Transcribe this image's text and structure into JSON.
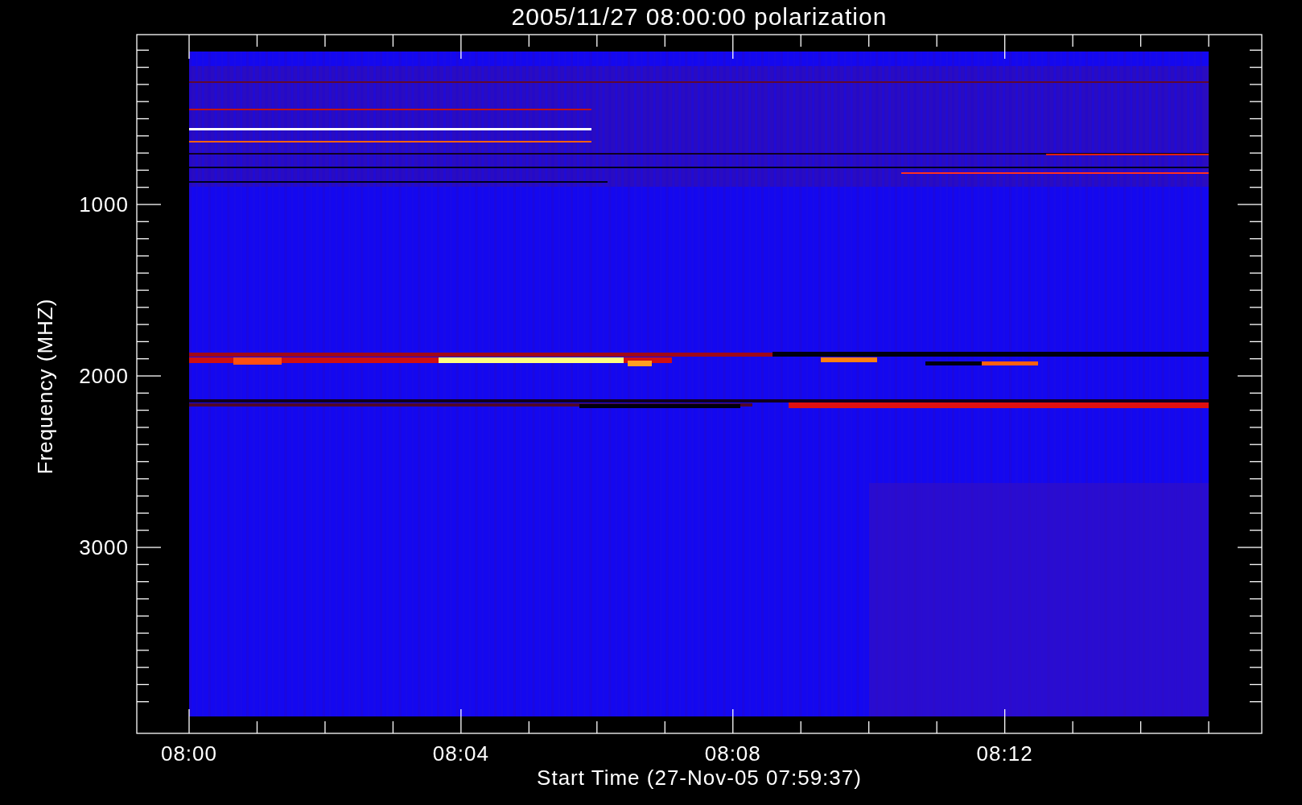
{
  "chart": {
    "title": "2005/11/27 08:00:00 polarization",
    "y_axis": {
      "label": "Frequency (MHZ)",
      "ticks": [
        "1000",
        "2000",
        "3000"
      ]
    },
    "x_axis": {
      "label": "Start Time (27-Nov-05 07:59:37)",
      "ticks": [
        "08:00",
        "08:04",
        "08:08",
        "08:12"
      ]
    }
  }
}
